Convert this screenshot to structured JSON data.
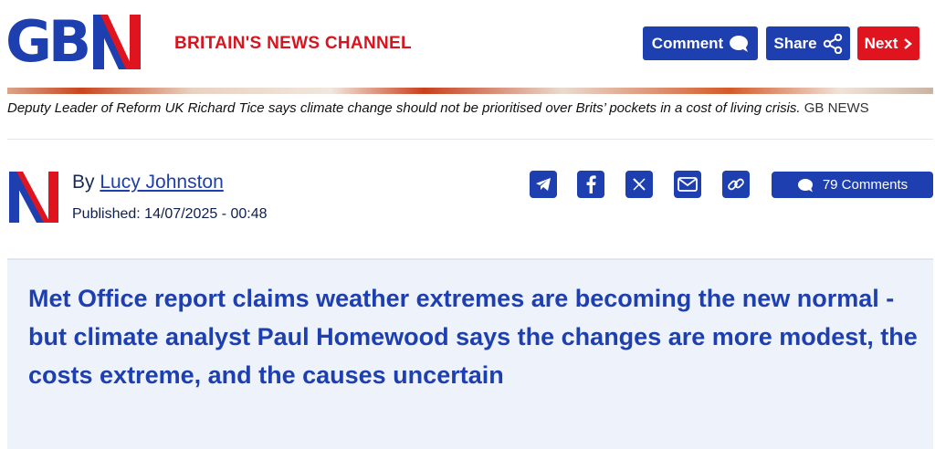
{
  "header": {
    "logo_text": "GBN",
    "tagline": "BRITAIN'S NEWS CHANNEL",
    "buttons": {
      "comment": "Comment",
      "share": "Share",
      "next": "Next"
    }
  },
  "colors": {
    "brand_blue": "#1d3fb0",
    "brand_red": "#e0141e",
    "standfirst_bg": "#eef2fb"
  },
  "caption": {
    "text": "Deputy Leader of Reform UK Richard Tice says climate change should not be prioritised over Brits’ pockets in a cost of living crisis.",
    "credit": "GB NEWS"
  },
  "author": {
    "by_prefix": "By",
    "name": "Lucy Johnston",
    "published_label": "Published: 14/07/2025 - 00:48"
  },
  "share_icons": [
    "telegram-icon",
    "facebook-icon",
    "x-icon",
    "email-icon",
    "link-icon"
  ],
  "comments": {
    "label": "79 Comments"
  },
  "standfirst": "Met Office report claims weather extremes are becoming the new normal - but climate analyst Paul Homewood says the changes are more modest, the costs extreme, and the causes uncertain"
}
